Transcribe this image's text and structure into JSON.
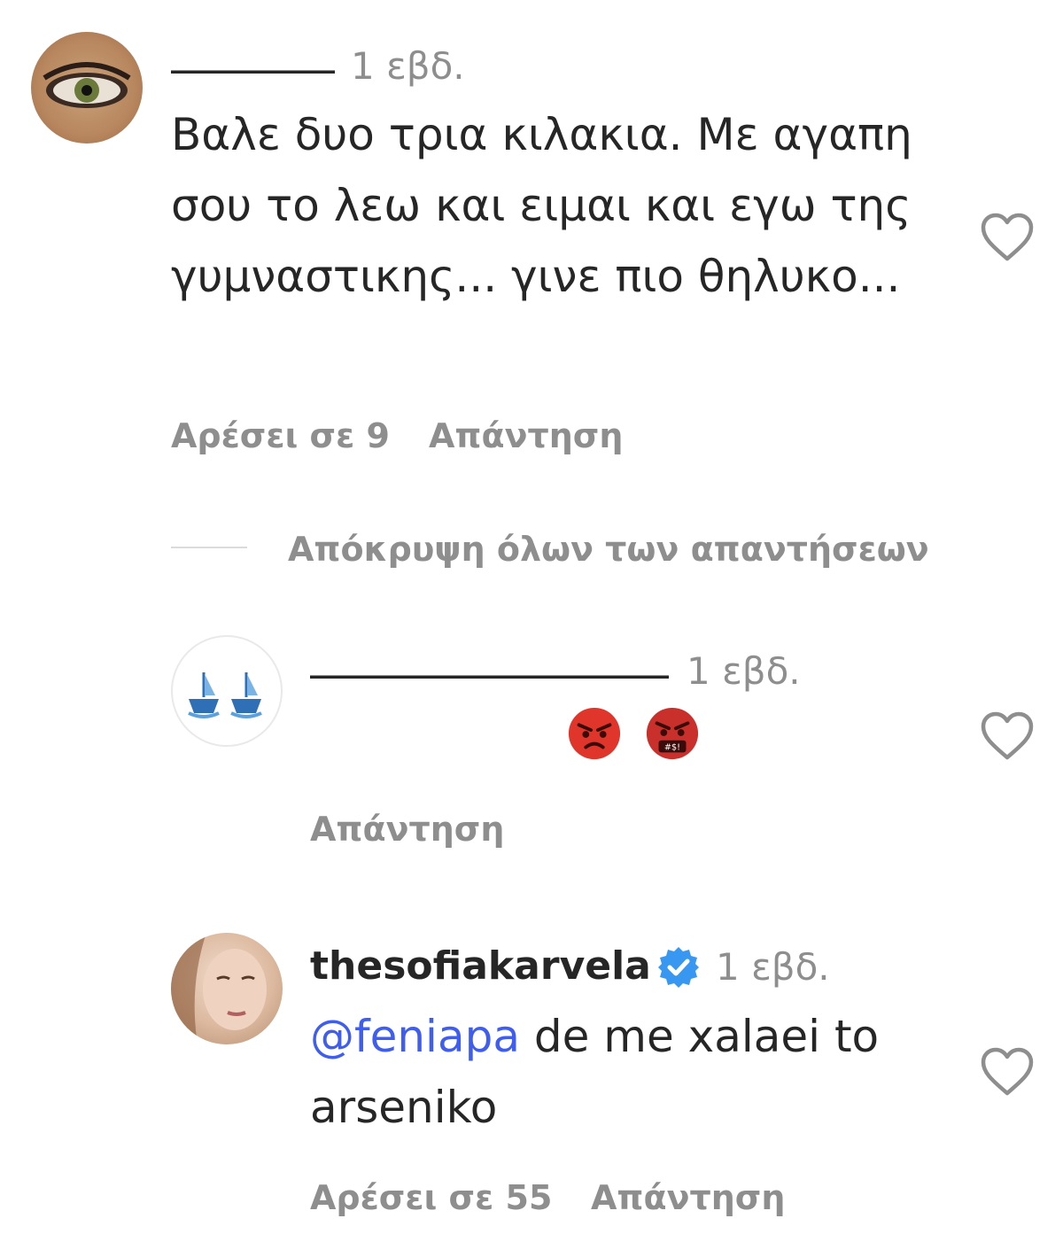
{
  "comments": [
    {
      "username": "",
      "time": "1 εβδ.",
      "text": "Βαλε δυο τρια κιλακια. Με αγαπη σου το λεω και ειμαι και εγω της γυμναστικης... γινε πιο θηλυκο...",
      "likes_label": "Αρέσει σε 9",
      "reply_label": "Απάντηση"
    }
  ],
  "thread": {
    "hide_replies_label": "Απόκρυψη όλων των απαντήσεων"
  },
  "replies": [
    {
      "username": "",
      "time": "1 εβδ.",
      "emojis": [
        "angry-face-emoji",
        "angry-face-with-symbols-emoji"
      ],
      "reply_label": "Απάντηση"
    },
    {
      "username": "thesofiakarvela",
      "verified": true,
      "time": "1 εβδ.",
      "mention": "@feniapa",
      "text": "de me xalaei to arseniko",
      "likes_label": "Αρέσει σε 55",
      "reply_label": "Απάντηση"
    }
  ],
  "colors": {
    "text": "#262626",
    "secondary": "#8e8e8e",
    "mention": "#3f5ef0",
    "verified": "#3897f0"
  }
}
